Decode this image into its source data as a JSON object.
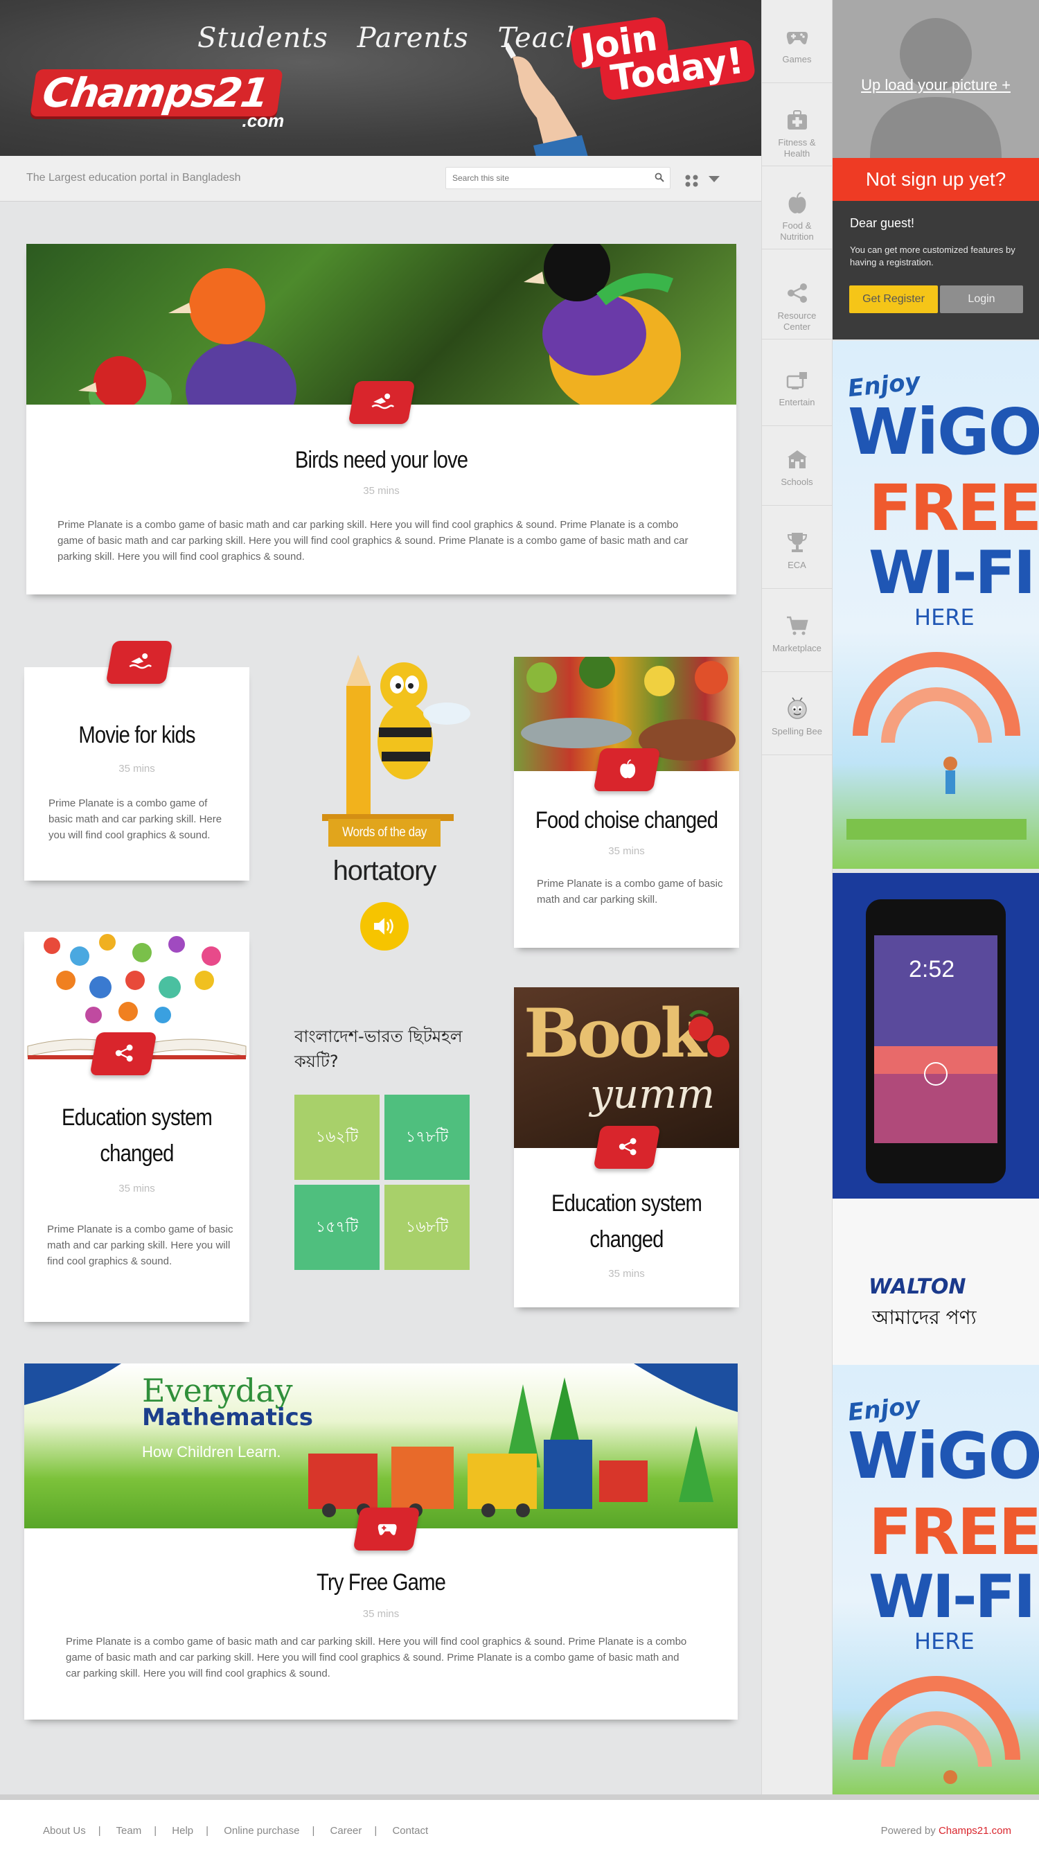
{
  "header": {
    "audiences": [
      "Students",
      "Parents",
      "Teachers"
    ],
    "logo_main": "Champs21",
    "logo_domain": ".com",
    "join_line1": "Join",
    "join_line2": "Today!"
  },
  "subbar": {
    "tagline": "The Largest education portal in Bangladesh",
    "search_placeholder": "Search this site"
  },
  "nav": [
    {
      "label": "Games",
      "icon": "gamepad-icon"
    },
    {
      "label": "Fitness & Health",
      "icon": "first-aid-icon"
    },
    {
      "label": "Food & Nutrition",
      "icon": "apple-icon"
    },
    {
      "label": "Resource Center",
      "icon": "share-icon"
    },
    {
      "label": "Entertain",
      "icon": "tv-gift-icon"
    },
    {
      "label": "Schools",
      "icon": "school-icon"
    },
    {
      "label": "ECA",
      "icon": "trophy-icon"
    },
    {
      "label": "Marketplace",
      "icon": "cart-icon"
    },
    {
      "label": "Spelling Bee",
      "icon": "bee-icon"
    }
  ],
  "profile": {
    "upload_label": "Up load your picture +"
  },
  "signup": {
    "heading": "Not sign up yet?",
    "greeting": "Dear guest!",
    "note": "You can get more customized features by having a registration.",
    "register_label": "Get Register",
    "login_label": "Login"
  },
  "ads": {
    "wigo_enjoy": "Enjoy",
    "wigo_name": "WiGO",
    "wigo_free": "FREE",
    "wigo_wifi": "WI-FI",
    "wigo_here": "HERE",
    "phone_time": "2:52",
    "walton_logo": "WALTON",
    "walton_tag": "আমাদের পণ্য"
  },
  "cards": {
    "birds": {
      "title": "Birds need your love",
      "meta": "35 mins",
      "body": "Prime Planate is a combo game of basic math and car parking skill. Here you will find cool graphics & sound. Prime Planate is a combo game of basic math and car parking skill. Here you will find cool graphics & sound. Prime Planate is a combo game of basic math and car parking skill. Here you will find cool graphics & sound."
    },
    "movie": {
      "title": "Movie for kids",
      "meta": "35 mins",
      "body": "Prime Planate is a combo game of basic math and car parking skill. Here you will find cool graphics & sound."
    },
    "food": {
      "title": "Food choise changed",
      "meta": "35 mins",
      "body": "Prime Planate is a combo game of basic math and car parking skill."
    },
    "edu1": {
      "title_l1": "Education system",
      "title_l2": "changed",
      "meta": "35 mins",
      "body": "Prime Planate is a combo game of basic math and car parking skill. Here you will find cool graphics & sound."
    },
    "edu2": {
      "title_l1": "Education system",
      "title_l2": "changed",
      "meta": "35 mins",
      "book_text": "Book",
      "book_sub": "yumm"
    },
    "game": {
      "title": "Try Free Game",
      "meta": "35 mins",
      "brand_l1": "Everyday",
      "brand_l2": "Mathematics",
      "brand_l3": "How Children Learn.",
      "body": "Prime Planate is a combo game of basic math and car parking skill. Here you will find cool graphics & sound. Prime Planate is a combo game of basic math and car parking skill. Here you will find cool graphics & sound. Prime Planate is a combo game of basic math and car parking skill. Here you will find cool graphics & sound."
    }
  },
  "word_of_day": {
    "label": "Words of the day",
    "word": "hortatory"
  },
  "quiz": {
    "question": "বাংলাদেশ-ভারত ছিটমহল কয়টি?",
    "options": [
      "১৬২টি",
      "১৭৮টি",
      "১৫৭টি",
      "১৬৮টি"
    ],
    "colors": [
      "#a8d06a",
      "#4fbf7e",
      "#4fbf7e",
      "#a8d06a"
    ]
  },
  "footer": {
    "links": [
      "About Us",
      "Team",
      "Help",
      "Online purchase",
      "Career",
      "Contact"
    ],
    "powered_prefix": "Powered by ",
    "powered_brand": "Champs21.com"
  }
}
